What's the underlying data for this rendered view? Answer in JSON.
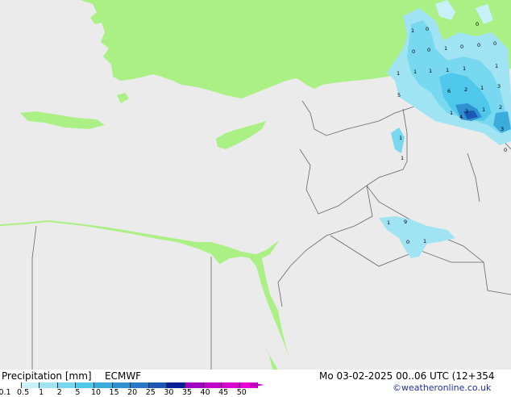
{
  "footer": {
    "title": "Precipitation [mm]",
    "model": "ECMWF",
    "datetime": "Mo 03-02-2025 00..06 UTC (12+354",
    "credit": "©weatheronline.co.uk"
  },
  "legend": {
    "ticks": [
      "0.1",
      "0.5",
      "1",
      "2",
      "5",
      "10",
      "15",
      "20",
      "25",
      "30",
      "35",
      "40",
      "45",
      "50"
    ],
    "colors": [
      "#ffffff",
      "#c8f0f8",
      "#a0e4f4",
      "#78d8f0",
      "#50c8ec",
      "#3cacdc",
      "#3090d0",
      "#2878c8",
      "#1c58b4",
      "#0a1e96",
      "#a000c0",
      "#c000c8",
      "#d800d0",
      "#e800d8"
    ]
  },
  "map_values": [
    "1",
    "0",
    "0",
    "0",
    "1",
    "0",
    "0",
    "1",
    "1",
    "1",
    "1",
    "1",
    "1",
    "1",
    "1",
    "1",
    "1",
    "5",
    "6",
    "2",
    "1",
    "3",
    "1",
    "3",
    "1",
    "2",
    "4",
    "3",
    "1",
    "1",
    "0",
    "1",
    "9",
    "0",
    "1"
  ]
}
